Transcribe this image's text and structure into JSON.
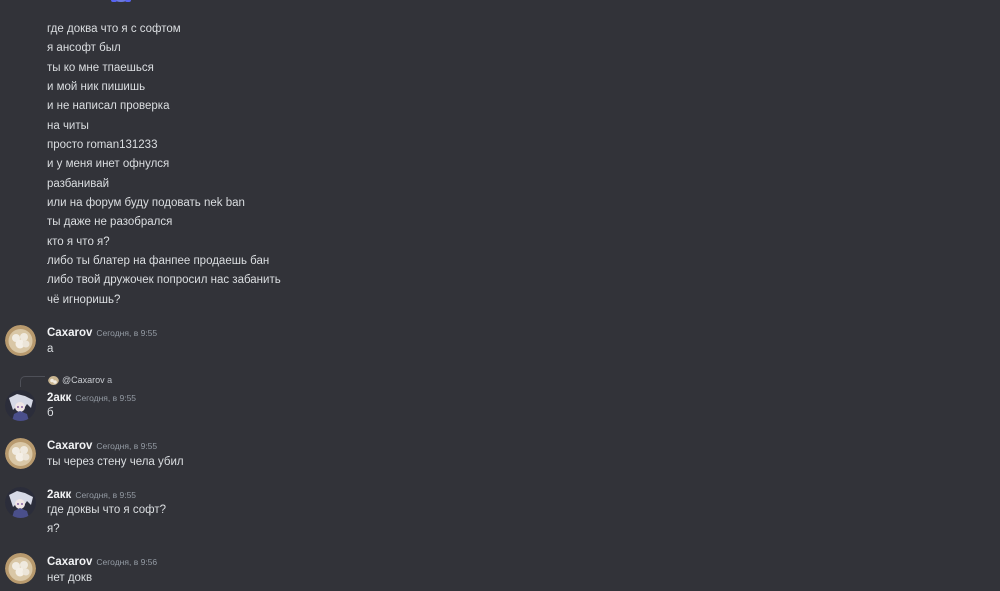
{
  "colors": {
    "background": "#323339",
    "text": "#dbdee1",
    "username": "#f2f3f5",
    "timestamp": "#949ba4"
  },
  "continuation_lines": [
    "где доква что я с софтом",
    "я ансофт был",
    "ты ко мне тпаешься",
    "и мой ник пишишь",
    "и не написал проверка",
    "на читы",
    "просто roman131233",
    "и у меня инет офнулся",
    "разбанивай",
    "или на форум буду подовать nek ban",
    "ты даже не разобрался",
    "кто я что я?",
    "либо ты блатер на фанпее продаешь бан",
    "либо твой дружочек попросил нас забанить",
    "чё игноришь?"
  ],
  "messages": [
    {
      "avatar": "dumplings-avatar",
      "username": "Caxarov",
      "timestamp": "Сегодня, в 9:55",
      "lines": [
        "а"
      ]
    },
    {
      "avatar": "anime-avatar",
      "reply": {
        "mention": "@Caxarov",
        "text": "а"
      },
      "username": "2акк",
      "timestamp": "Сегодня, в 9:55",
      "lines": [
        "б"
      ]
    },
    {
      "avatar": "dumplings-avatar",
      "username": "Caxarov",
      "timestamp": "Сегодня, в 9:55",
      "lines": [
        "ты через стену чела убил"
      ]
    },
    {
      "avatar": "anime-avatar",
      "username": "2акк",
      "timestamp": "Сегодня, в 9:55",
      "lines": [
        "где доквы что я софт?",
        "я?"
      ]
    },
    {
      "avatar": "dumplings-avatar",
      "username": "Caxarov",
      "timestamp": "Сегодня, в 9:56",
      "lines": [
        "нет докв"
      ]
    }
  ]
}
